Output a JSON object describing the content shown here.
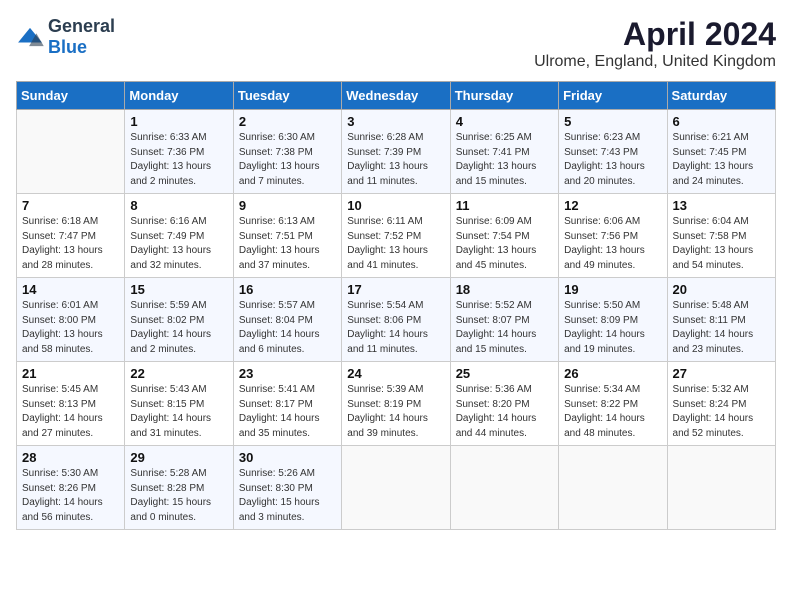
{
  "header": {
    "logo_general": "General",
    "logo_blue": "Blue",
    "month_year": "April 2024",
    "location": "Ulrome, England, United Kingdom"
  },
  "days_of_week": [
    "Sunday",
    "Monday",
    "Tuesday",
    "Wednesday",
    "Thursday",
    "Friday",
    "Saturday"
  ],
  "weeks": [
    [
      {
        "day": "",
        "info": ""
      },
      {
        "day": "1",
        "info": "Sunrise: 6:33 AM\nSunset: 7:36 PM\nDaylight: 13 hours\nand 2 minutes."
      },
      {
        "day": "2",
        "info": "Sunrise: 6:30 AM\nSunset: 7:38 PM\nDaylight: 13 hours\nand 7 minutes."
      },
      {
        "day": "3",
        "info": "Sunrise: 6:28 AM\nSunset: 7:39 PM\nDaylight: 13 hours\nand 11 minutes."
      },
      {
        "day": "4",
        "info": "Sunrise: 6:25 AM\nSunset: 7:41 PM\nDaylight: 13 hours\nand 15 minutes."
      },
      {
        "day": "5",
        "info": "Sunrise: 6:23 AM\nSunset: 7:43 PM\nDaylight: 13 hours\nand 20 minutes."
      },
      {
        "day": "6",
        "info": "Sunrise: 6:21 AM\nSunset: 7:45 PM\nDaylight: 13 hours\nand 24 minutes."
      }
    ],
    [
      {
        "day": "7",
        "info": "Sunrise: 6:18 AM\nSunset: 7:47 PM\nDaylight: 13 hours\nand 28 minutes."
      },
      {
        "day": "8",
        "info": "Sunrise: 6:16 AM\nSunset: 7:49 PM\nDaylight: 13 hours\nand 32 minutes."
      },
      {
        "day": "9",
        "info": "Sunrise: 6:13 AM\nSunset: 7:51 PM\nDaylight: 13 hours\nand 37 minutes."
      },
      {
        "day": "10",
        "info": "Sunrise: 6:11 AM\nSunset: 7:52 PM\nDaylight: 13 hours\nand 41 minutes."
      },
      {
        "day": "11",
        "info": "Sunrise: 6:09 AM\nSunset: 7:54 PM\nDaylight: 13 hours\nand 45 minutes."
      },
      {
        "day": "12",
        "info": "Sunrise: 6:06 AM\nSunset: 7:56 PM\nDaylight: 13 hours\nand 49 minutes."
      },
      {
        "day": "13",
        "info": "Sunrise: 6:04 AM\nSunset: 7:58 PM\nDaylight: 13 hours\nand 54 minutes."
      }
    ],
    [
      {
        "day": "14",
        "info": "Sunrise: 6:01 AM\nSunset: 8:00 PM\nDaylight: 13 hours\nand 58 minutes."
      },
      {
        "day": "15",
        "info": "Sunrise: 5:59 AM\nSunset: 8:02 PM\nDaylight: 14 hours\nand 2 minutes."
      },
      {
        "day": "16",
        "info": "Sunrise: 5:57 AM\nSunset: 8:04 PM\nDaylight: 14 hours\nand 6 minutes."
      },
      {
        "day": "17",
        "info": "Sunrise: 5:54 AM\nSunset: 8:06 PM\nDaylight: 14 hours\nand 11 minutes."
      },
      {
        "day": "18",
        "info": "Sunrise: 5:52 AM\nSunset: 8:07 PM\nDaylight: 14 hours\nand 15 minutes."
      },
      {
        "day": "19",
        "info": "Sunrise: 5:50 AM\nSunset: 8:09 PM\nDaylight: 14 hours\nand 19 minutes."
      },
      {
        "day": "20",
        "info": "Sunrise: 5:48 AM\nSunset: 8:11 PM\nDaylight: 14 hours\nand 23 minutes."
      }
    ],
    [
      {
        "day": "21",
        "info": "Sunrise: 5:45 AM\nSunset: 8:13 PM\nDaylight: 14 hours\nand 27 minutes."
      },
      {
        "day": "22",
        "info": "Sunrise: 5:43 AM\nSunset: 8:15 PM\nDaylight: 14 hours\nand 31 minutes."
      },
      {
        "day": "23",
        "info": "Sunrise: 5:41 AM\nSunset: 8:17 PM\nDaylight: 14 hours\nand 35 minutes."
      },
      {
        "day": "24",
        "info": "Sunrise: 5:39 AM\nSunset: 8:19 PM\nDaylight: 14 hours\nand 39 minutes."
      },
      {
        "day": "25",
        "info": "Sunrise: 5:36 AM\nSunset: 8:20 PM\nDaylight: 14 hours\nand 44 minutes."
      },
      {
        "day": "26",
        "info": "Sunrise: 5:34 AM\nSunset: 8:22 PM\nDaylight: 14 hours\nand 48 minutes."
      },
      {
        "day": "27",
        "info": "Sunrise: 5:32 AM\nSunset: 8:24 PM\nDaylight: 14 hours\nand 52 minutes."
      }
    ],
    [
      {
        "day": "28",
        "info": "Sunrise: 5:30 AM\nSunset: 8:26 PM\nDaylight: 14 hours\nand 56 minutes."
      },
      {
        "day": "29",
        "info": "Sunrise: 5:28 AM\nSunset: 8:28 PM\nDaylight: 15 hours\nand 0 minutes."
      },
      {
        "day": "30",
        "info": "Sunrise: 5:26 AM\nSunset: 8:30 PM\nDaylight: 15 hours\nand 3 minutes."
      },
      {
        "day": "",
        "info": ""
      },
      {
        "day": "",
        "info": ""
      },
      {
        "day": "",
        "info": ""
      },
      {
        "day": "",
        "info": ""
      }
    ]
  ]
}
